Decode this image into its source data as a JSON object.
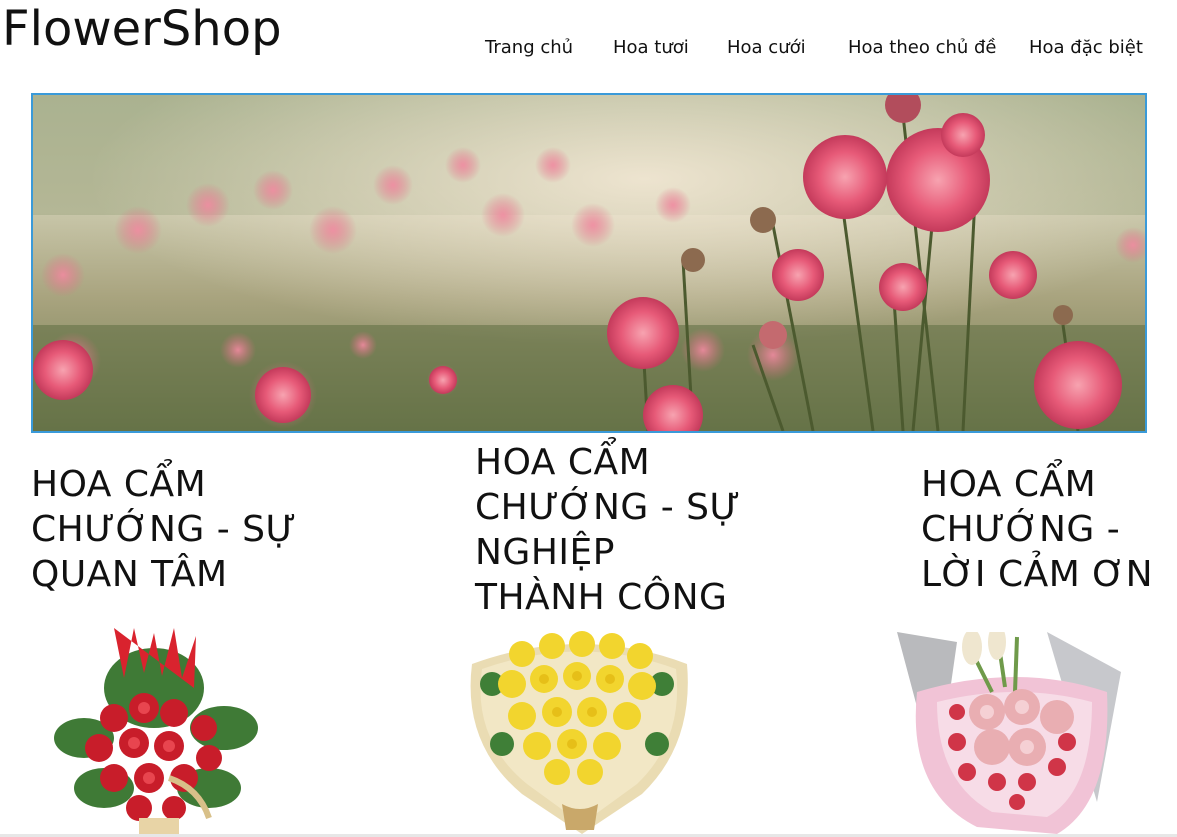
{
  "header": {
    "logo": "FlowerShop",
    "nav": [
      {
        "label": "Trang chủ"
      },
      {
        "label": "Hoa tươi"
      },
      {
        "label": "Hoa cưới"
      },
      {
        "label": "Hoa theo chủ đề"
      },
      {
        "label": "Hoa đặc biệt"
      }
    ]
  },
  "banner": {
    "icon": "flower-field-banner-image",
    "accent": "#3a9ad9"
  },
  "products": [
    {
      "title_lines": [
        "HOA CẨM",
        "CHƯỚNG - SỰ",
        "QUAN TÂM"
      ],
      "image": "red-flower-basket-image"
    },
    {
      "title_lines": [
        "HOA CẨM",
        "CHƯỚNG - SỰ",
        "NGHIỆP",
        "THÀNH CÔNG"
      ],
      "image": "yellow-rose-bouquet-image"
    },
    {
      "title_lines": [
        "HOA CẨM",
        "CHƯỚNG -",
        "LỜI CẢM ƠN"
      ],
      "image": "pink-rose-bouquet-image"
    }
  ]
}
